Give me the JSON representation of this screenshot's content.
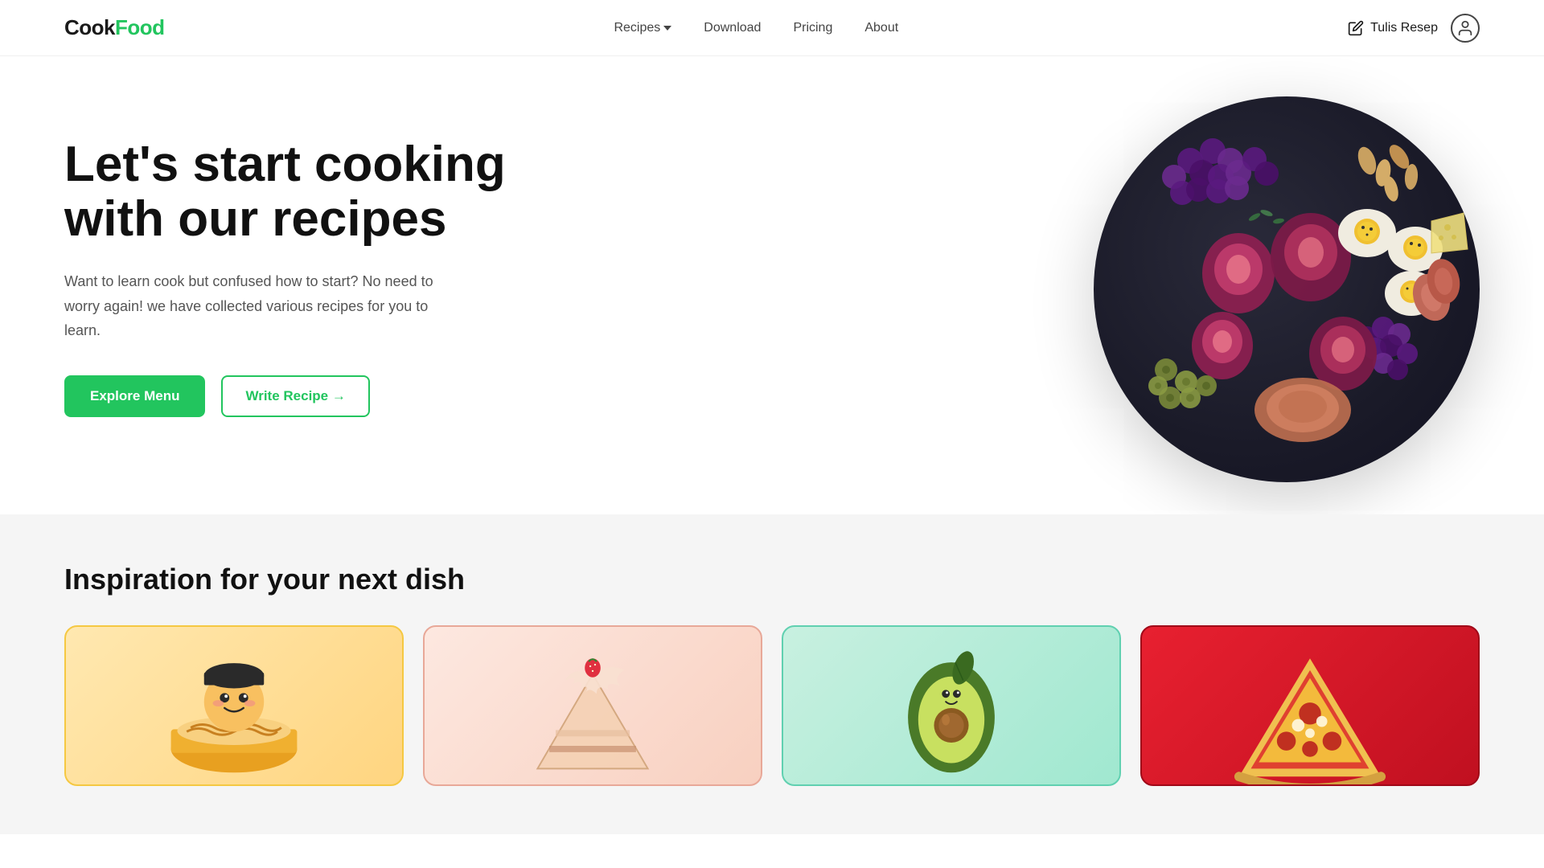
{
  "logo": {
    "cook": "Cook",
    "food": "Food"
  },
  "nav": {
    "recipes_label": "Recipes",
    "download_label": "Download",
    "pricing_label": "Pricing",
    "about_label": "About",
    "tulis_resep_label": "Tulis Resep"
  },
  "hero": {
    "title": "Let's start cooking with our recipes",
    "description": "Want to learn cook but confused how to start? No need to worry again! we have collected various recipes for you to learn.",
    "explore_label": "Explore Menu",
    "write_label": "Write Recipe →"
  },
  "inspiration": {
    "section_title": "Inspiration for your next dish",
    "cards": [
      {
        "id": "card-1",
        "color_class": "card-yellow",
        "emoji": "🍜"
      },
      {
        "id": "card-2",
        "color_class": "card-peach",
        "emoji": "🍰"
      },
      {
        "id": "card-3",
        "color_class": "card-mint",
        "emoji": "🥑"
      },
      {
        "id": "card-4",
        "color_class": "card-red",
        "emoji": "🍕"
      }
    ]
  },
  "colors": {
    "green_accent": "#22c55e",
    "text_dark": "#111111",
    "text_muted": "#555555"
  }
}
